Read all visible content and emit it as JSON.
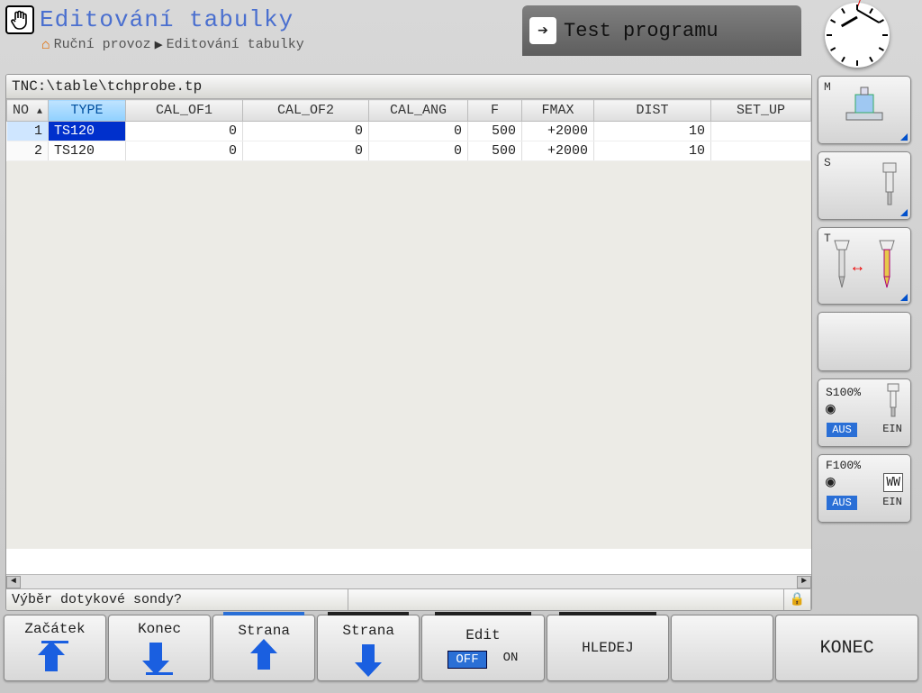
{
  "header": {
    "title": "Editování tabulky",
    "breadcrumb_root": "Ruční provoz",
    "breadcrumb_leaf": "Editování tabulky"
  },
  "program_tab": {
    "label": "Test programu"
  },
  "file_path": "TNC:\\table\\tchprobe.tp",
  "table": {
    "columns": [
      "NO",
      "TYPE",
      "CAL_OF1",
      "CAL_OF2",
      "CAL_ANG",
      "F",
      "FMAX",
      "DIST",
      "SET_UP"
    ],
    "rows": [
      {
        "no": "1",
        "type": "TS120",
        "cal_of1": "0",
        "cal_of2": "0",
        "cal_ang": "0",
        "f": "500",
        "fmax": "+2000",
        "dist": "10",
        "set_up": ""
      },
      {
        "no": "2",
        "type": "TS120",
        "cal_of1": "0",
        "cal_of2": "0",
        "cal_ang": "0",
        "f": "500",
        "fmax": "+2000",
        "dist": "10",
        "set_up": ""
      }
    ]
  },
  "status": {
    "prompt": "Výběr dotykové sondy?"
  },
  "right": {
    "m": "M",
    "s": "S",
    "t": "T",
    "s100": "S100%",
    "f100": "F100%",
    "aus": "AUS",
    "ein": "EIN"
  },
  "softkeys": {
    "k1": "Začátek",
    "k2": "Konec",
    "k3": "Strana",
    "k4": "Strana",
    "k5": "Edit",
    "k5_off": "OFF",
    "k5_on": "ON",
    "k6": "HLEDEJ",
    "k8": "KONEC"
  }
}
